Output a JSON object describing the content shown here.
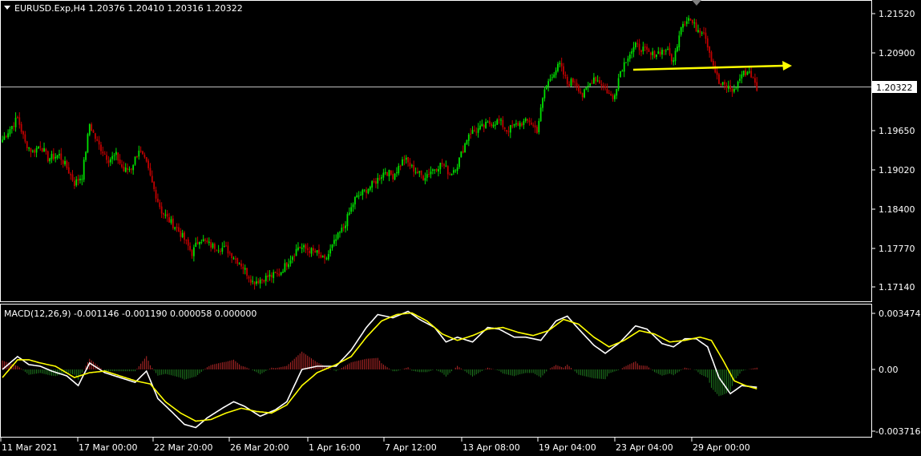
{
  "header": {
    "symbol_line": "EURUSD.Exp,H4  1.20376 1.20410 1.20316 1.20322",
    "menu_icon": "triangle-down-icon"
  },
  "price_axis": {
    "ticks": [
      "1.21520",
      "1.20900",
      "1.20322",
      "1.19650",
      "1.19020",
      "1.18400",
      "1.17770",
      "1.17140"
    ],
    "current_price": "1.20322"
  },
  "macd": {
    "label": "MACD(12,26,9) -0.001146 -0.001190 0.000058 0.000000",
    "ticks": [
      "0.003474",
      "0.00",
      "-0.003716"
    ]
  },
  "time_axis": {
    "ticks": [
      "11 Mar 2021",
      "17 Mar 00:00",
      "22 Mar 20:00",
      "26 Mar 20:00",
      "1 Apr 16:00",
      "7 Apr 12:00",
      "13 Apr 08:00",
      "19 Apr 04:00",
      "23 Apr 04:00",
      "29 Apr 00:00"
    ]
  },
  "colors": {
    "background": "#000000",
    "bull": "#00e000",
    "bear": "#c00000",
    "grid": "#ffffff",
    "macd_line": "#ffffff",
    "signal_line": "#ffff00",
    "hist_pos": "#b42828",
    "hist_neg": "#1f7a1f",
    "arrow": "#ffff00"
  },
  "chart_data": {
    "type": "candlestick",
    "symbol": "EURUSD.Exp",
    "timeframe": "H4",
    "ylim": [
      1.1685,
      1.217
    ],
    "close_path": [
      [
        0,
        1.195
      ],
      [
        8,
        1.1985
      ],
      [
        12,
        1.1945
      ],
      [
        16,
        1.193
      ],
      [
        20,
        1.1942
      ],
      [
        24,
        1.192
      ],
      [
        30,
        1.1925
      ],
      [
        34,
        1.1905
      ],
      [
        38,
        1.188
      ],
      [
        42,
        1.1892
      ],
      [
        46,
        1.1975
      ],
      [
        50,
        1.1945
      ],
      [
        56,
        1.1918
      ],
      [
        60,
        1.1925
      ],
      [
        64,
        1.19
      ],
      [
        68,
        1.1905
      ],
      [
        72,
        1.1935
      ],
      [
        76,
        1.191
      ],
      [
        80,
        1.187
      ],
      [
        84,
        1.1835
      ],
      [
        88,
        1.182
      ],
      [
        92,
        1.1808
      ],
      [
        96,
        1.179
      ],
      [
        100,
        1.1768
      ],
      [
        104,
        1.1792
      ],
      [
        110,
        1.178
      ],
      [
        118,
        1.1775
      ],
      [
        126,
        1.175
      ],
      [
        132,
        1.1722
      ],
      [
        140,
        1.173
      ],
      [
        146,
        1.1735
      ],
      [
        152,
        1.176
      ],
      [
        156,
        1.1778
      ],
      [
        160,
        1.1775
      ],
      [
        166,
        1.1768
      ],
      [
        170,
        1.1755
      ],
      [
        176,
        1.179
      ],
      [
        180,
        1.181
      ],
      [
        186,
        1.1855
      ],
      [
        192,
        1.187
      ],
      [
        196,
        1.188
      ],
      [
        202,
        1.19
      ],
      [
        206,
        1.1892
      ],
      [
        212,
        1.192
      ],
      [
        216,
        1.1905
      ],
      [
        222,
        1.189
      ],
      [
        226,
        1.19
      ],
      [
        232,
        1.1912
      ],
      [
        236,
        1.1895
      ],
      [
        240,
        1.191
      ],
      [
        246,
        1.196
      ],
      [
        252,
        1.1968
      ],
      [
        256,
        1.1975
      ],
      [
        262,
        1.198
      ],
      [
        266,
        1.1965
      ],
      [
        272,
        1.1975
      ],
      [
        278,
        1.198
      ],
      [
        282,
        1.1965
      ],
      [
        286,
        1.203
      ],
      [
        290,
        1.2055
      ],
      [
        294,
        1.207
      ],
      [
        298,
        1.204
      ],
      [
        302,
        1.2045
      ],
      [
        306,
        1.202
      ],
      [
        312,
        1.205
      ],
      [
        316,
        1.204
      ],
      [
        322,
        1.2015
      ],
      [
        326,
        1.206
      ],
      [
        330,
        1.2085
      ],
      [
        334,
        1.21
      ],
      [
        338,
        1.2095
      ],
      [
        342,
        1.2085
      ],
      [
        346,
        1.209
      ],
      [
        350,
        1.2095
      ],
      [
        354,
        1.2075
      ],
      [
        358,
        1.2135
      ],
      [
        362,
        1.2145
      ],
      [
        366,
        1.2128
      ],
      [
        370,
        1.2125
      ],
      [
        374,
        1.208
      ],
      [
        378,
        1.204
      ],
      [
        382,
        1.2035
      ],
      [
        386,
        1.2028
      ],
      [
        390,
        1.2055
      ],
      [
        394,
        1.206
      ],
      [
        398,
        1.2032
      ]
    ],
    "macd_line": [
      [
        0,
        0.0
      ],
      [
        8,
        0.0008
      ],
      [
        14,
        0.0003
      ],
      [
        20,
        0.0002
      ],
      [
        26,
        -0.0001
      ],
      [
        34,
        -0.0004
      ],
      [
        40,
        -0.001
      ],
      [
        46,
        0.0004
      ],
      [
        54,
        -0.0002
      ],
      [
        62,
        -0.0005
      ],
      [
        70,
        -0.0008
      ],
      [
        76,
        -0.0001
      ],
      [
        82,
        -0.0018
      ],
      [
        90,
        -0.0027
      ],
      [
        96,
        -0.0034
      ],
      [
        102,
        -0.0036
      ],
      [
        108,
        -0.003
      ],
      [
        116,
        -0.0024
      ],
      [
        122,
        -0.002
      ],
      [
        128,
        -0.0023
      ],
      [
        136,
        -0.0029
      ],
      [
        144,
        -0.0025
      ],
      [
        150,
        -0.002
      ],
      [
        158,
        0.0
      ],
      [
        166,
        0.0002
      ],
      [
        176,
        0.0002
      ],
      [
        184,
        0.0012
      ],
      [
        192,
        0.0026
      ],
      [
        198,
        0.0034
      ],
      [
        206,
        0.0032
      ],
      [
        214,
        0.0036
      ],
      [
        220,
        0.0031
      ],
      [
        228,
        0.0026
      ],
      [
        234,
        0.0017
      ],
      [
        240,
        0.002
      ],
      [
        248,
        0.0017
      ],
      [
        256,
        0.0026
      ],
      [
        262,
        0.0025
      ],
      [
        270,
        0.002
      ],
      [
        276,
        0.002
      ],
      [
        284,
        0.0018
      ],
      [
        292,
        0.003
      ],
      [
        298,
        0.0033
      ],
      [
        304,
        0.0025
      ],
      [
        312,
        0.0015
      ],
      [
        318,
        0.001
      ],
      [
        326,
        0.0017
      ],
      [
        334,
        0.0027
      ],
      [
        340,
        0.0025
      ],
      [
        348,
        0.0016
      ],
      [
        354,
        0.0014
      ],
      [
        360,
        0.0019
      ],
      [
        366,
        0.0019
      ],
      [
        372,
        0.0014
      ],
      [
        378,
        -0.0005
      ],
      [
        384,
        -0.0015
      ],
      [
        390,
        -0.001
      ],
      [
        398,
        -0.0011
      ]
    ],
    "signal_line": [
      [
        0,
        -0.0005
      ],
      [
        8,
        0.0006
      ],
      [
        14,
        0.0006
      ],
      [
        20,
        0.0004
      ],
      [
        28,
        0.0002
      ],
      [
        38,
        -0.0005
      ],
      [
        46,
        -0.0002
      ],
      [
        54,
        -0.0001
      ],
      [
        62,
        -0.0004
      ],
      [
        70,
        -0.0007
      ],
      [
        78,
        -0.0009
      ],
      [
        86,
        -0.002
      ],
      [
        94,
        -0.0027
      ],
      [
        102,
        -0.0032
      ],
      [
        110,
        -0.0031
      ],
      [
        118,
        -0.0027
      ],
      [
        126,
        -0.0024
      ],
      [
        134,
        -0.0026
      ],
      [
        142,
        -0.0027
      ],
      [
        150,
        -0.0022
      ],
      [
        158,
        -0.001
      ],
      [
        166,
        -0.0002
      ],
      [
        176,
        0.0003
      ],
      [
        184,
        0.0008
      ],
      [
        192,
        0.002
      ],
      [
        200,
        0.003
      ],
      [
        208,
        0.0034
      ],
      [
        216,
        0.0035
      ],
      [
        224,
        0.003
      ],
      [
        232,
        0.0022
      ],
      [
        240,
        0.0018
      ],
      [
        248,
        0.0021
      ],
      [
        256,
        0.0025
      ],
      [
        264,
        0.0026
      ],
      [
        272,
        0.0023
      ],
      [
        280,
        0.0021
      ],
      [
        288,
        0.0024
      ],
      [
        296,
        0.0031
      ],
      [
        304,
        0.0028
      ],
      [
        312,
        0.002
      ],
      [
        320,
        0.0014
      ],
      [
        328,
        0.0018
      ],
      [
        336,
        0.0024
      ],
      [
        344,
        0.0022
      ],
      [
        352,
        0.0017
      ],
      [
        360,
        0.0018
      ],
      [
        368,
        0.002
      ],
      [
        374,
        0.0018
      ],
      [
        380,
        0.0006
      ],
      [
        386,
        -0.0007
      ],
      [
        392,
        -0.001
      ],
      [
        398,
        -0.0012
      ]
    ]
  }
}
